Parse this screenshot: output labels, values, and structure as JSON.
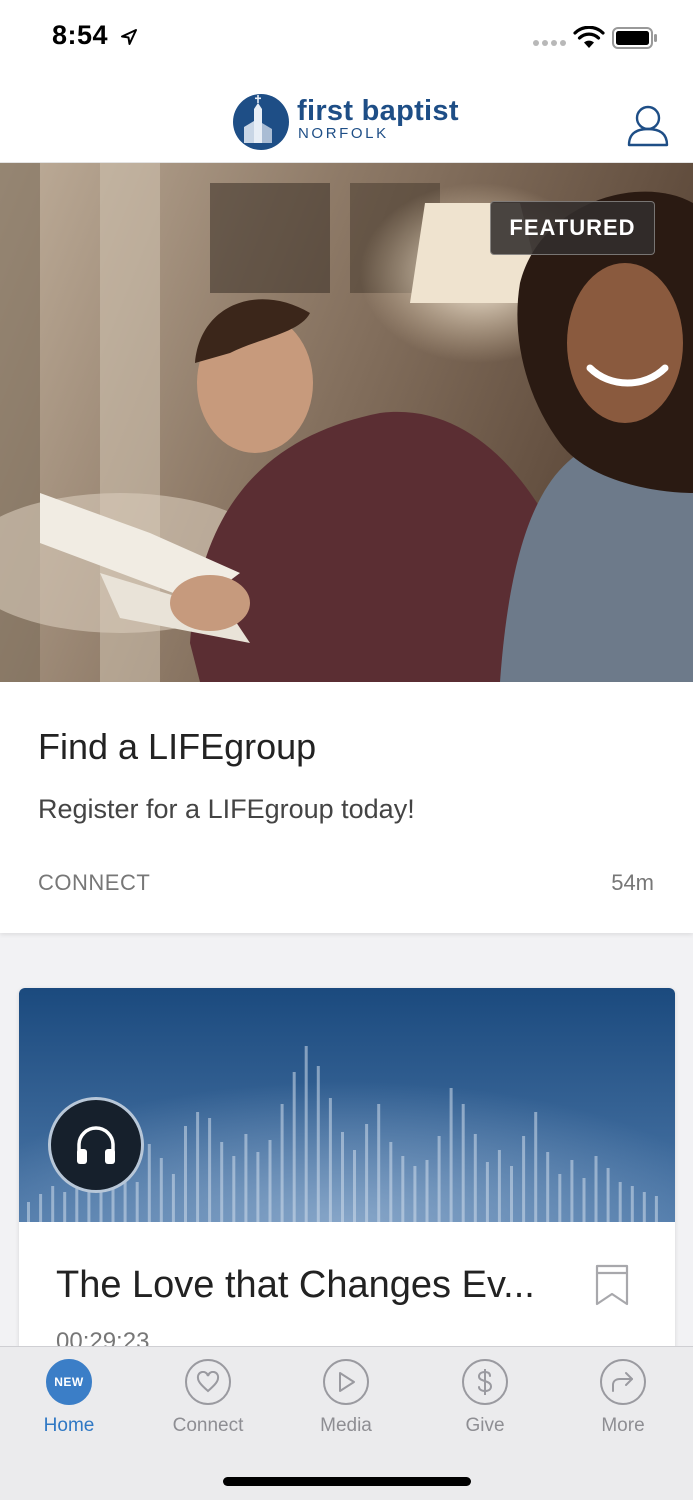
{
  "status_bar": {
    "time": "8:54"
  },
  "header": {
    "logo_title": "first baptist",
    "logo_subtitle": "NORFOLK",
    "brand_color": "#1e4e86"
  },
  "featured": {
    "badge": "FEATURED",
    "title": "Find a LIFEgroup",
    "description": "Register for a LIFEgroup today!",
    "category": "CONNECT",
    "time_ago": "54m"
  },
  "media_item": {
    "type_icon": "headphones-icon",
    "title": "The Love that Changes Ev...",
    "duration": "00:29:23"
  },
  "tab_bar": {
    "accent_color": "#3b7ec7",
    "tabs": [
      {
        "label": "Home",
        "badge": "NEW",
        "icon": "home-new-badge",
        "active": true
      },
      {
        "label": "Connect",
        "icon": "heart-icon",
        "active": false
      },
      {
        "label": "Media",
        "icon": "play-icon",
        "active": false
      },
      {
        "label": "Give",
        "icon": "dollar-icon",
        "active": false
      },
      {
        "label": "More",
        "icon": "share-arrow-icon",
        "active": false
      }
    ]
  }
}
